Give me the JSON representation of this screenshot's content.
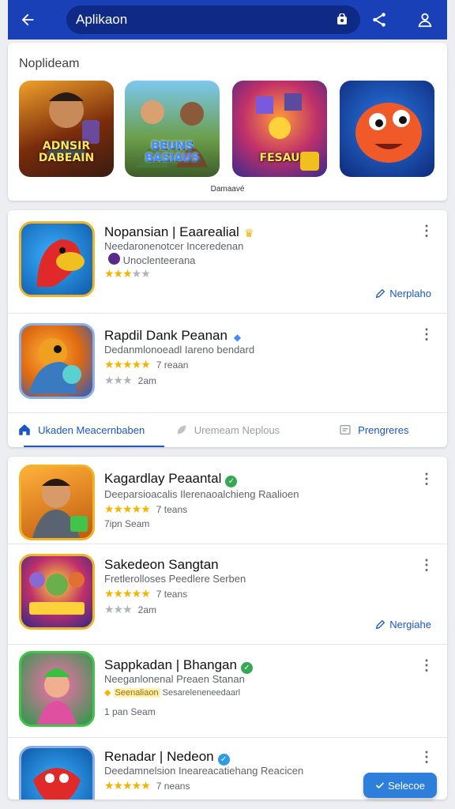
{
  "topbar": {
    "search_text": "Aplikaon"
  },
  "recommended": {
    "title": "Noplideam",
    "items": [
      {
        "caption": "ADNSIR DABEAIN"
      },
      {
        "caption": "BEUNS BASIAUS"
      },
      {
        "caption": "FESAU"
      },
      {
        "caption": ""
      }
    ],
    "footer": "Damaavé"
  },
  "list1": [
    {
      "title": "Nopansian | Eaarealial",
      "subtitle": "Needaronenotcer Inceredenan",
      "dev": "Unoclenteerana",
      "rating": 3,
      "meta": "",
      "action": "Nerplaho"
    },
    {
      "title": "Rapdil Dank Peanan",
      "subtitle": "Dedanmlonoeadl Iareno bendard",
      "dev": "",
      "rating": 5,
      "meta": "7 reaan",
      "rating2": 3,
      "meta2": "2am"
    }
  ],
  "tabs": [
    {
      "label": "Ukaden Meacernbaben",
      "icon": "home-icon"
    },
    {
      "label": "Uremeam Neplous",
      "icon": "leaf-icon"
    },
    {
      "label": "Prengreres",
      "icon": "list-icon"
    }
  ],
  "list2": [
    {
      "title": "Kagardlay Peaantal",
      "subtitle": "Deeparsioacalis Ilerenaoalchieng Raalioen",
      "rating": 5,
      "meta": "7 teans",
      "meta2": "7ipn  Seam"
    },
    {
      "title": "Sakedeon Sangtan",
      "subtitle": "Fretlerolloses Peedlere Serben",
      "rating": 5,
      "meta": "7 teans",
      "rating2": 3,
      "meta2": "2am",
      "action": "Nergiahe"
    },
    {
      "title": "Sappkadan | Bhangan",
      "subtitle": "Neeganlonenal Preaen Stanan",
      "promo": "Seenaliaon",
      "promo2": "Sesareleneneedaarl",
      "meta2": "1 pan  Seam"
    },
    {
      "title": "Renadar | Nedeon",
      "subtitle": "Deedamnelsion Ineareacatiehang Reacicen",
      "rating": 5,
      "meta": "7 neans"
    }
  ],
  "fab": {
    "label": "Selecoe"
  },
  "colors": {
    "primary": "#1a40b8",
    "accent": "#1a56c4",
    "star": "#f4b400"
  }
}
